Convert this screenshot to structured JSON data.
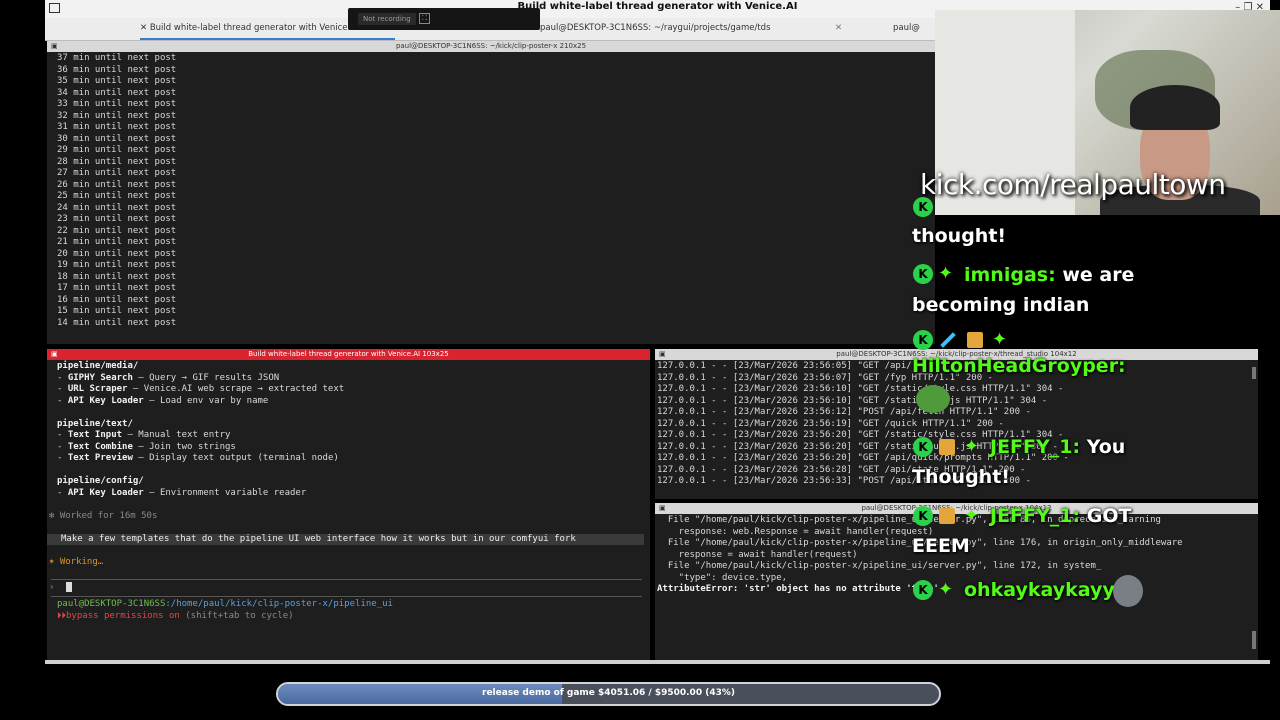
{
  "window": {
    "title": "Build white-label thread generator with Venice.AI",
    "controls": "–  ❐  ✕"
  },
  "recorder": {
    "status": "Not recording"
  },
  "tabs": [
    {
      "label": "Build white-label thread generator with Venice.AI"
    },
    {
      "label": "paul@DESKTOP-3C1N6SS: ~/raygui/projects/game/tds"
    },
    {
      "label": "paul@"
    }
  ],
  "pane_top": {
    "header": "paul@DESKTOP-3C1N6SS: ~/kick/clip-poster-x 210x25",
    "lines": [
      "37 min until next post",
      "36 min until next post",
      "35 min until next post",
      "34 min until next post",
      "33 min until next post",
      "32 min until next post",
      "31 min until next post",
      "30 min until next post",
      "29 min until next post",
      "28 min until next post",
      "27 min until next post",
      "26 min until next post",
      "25 min until next post",
      "24 min until next post",
      "23 min until next post",
      "22 min until next post",
      "21 min until next post",
      "20 min until next post",
      "19 min until next post",
      "18 min until next post",
      "17 min until next post",
      "16 min until next post",
      "15 min until next post",
      "14 min until next post"
    ]
  },
  "pane_claude": {
    "header": "Build white-label thread generator with Venice.AI 103x25",
    "media_heading": "pipeline/media/",
    "media_items": [
      {
        "name": "GIPHY Search",
        "desc": " — Query → GIF results JSON"
      },
      {
        "name": "URL Scraper",
        "desc": " — Venice.AI web scrape → extracted text"
      },
      {
        "name": "API Key Loader",
        "desc": " — Load env var by name"
      }
    ],
    "text_heading": "pipeline/text/",
    "text_items": [
      {
        "name": "Text Input",
        "desc": " — Manual text entry"
      },
      {
        "name": "Text Combine",
        "desc": " — Join two strings"
      },
      {
        "name": "Text Preview",
        "desc": " — Display text output (terminal node)"
      }
    ],
    "config_heading": "pipeline/config/",
    "config_items": [
      {
        "name": "API Key Loader",
        "desc": " — Environment variable reader"
      }
    ],
    "worked": "✻ Worked for 16m 50s",
    "prompt": "Make a few templates that do the pipeline UI web interface how it works but in our comfyui fork",
    "working": "✶ Working…",
    "input_prompt": "›",
    "cwd_user": "paul@DESKTOP-3C1N6SS",
    "cwd_path": ":/home/paul/kick/clip-poster-x/pipeline_ui",
    "bypass": "bypass permissions on",
    "bypass_hint": " (shift+tab to cycle)"
  },
  "pane_server": {
    "header": "paul@DESKTOP-3C1N6SS: ~/kick/clip-poster-x/thread_studio 104x12",
    "lines": [
      "127.0.0.1 - - [23/Mar/2026 23:56:05] \"GET /api/",
      "127.0.0.1 - - [23/Mar/2026 23:56:07] \"GET /fyp HTTP/1.1\" 200 -",
      "127.0.0.1 - - [23/Mar/2026 23:56:10] \"GET /static/style.css HTTP/1.1\" 304 -",
      "127.0.0.1 - - [23/Mar/2026 23:56:10] \"GET /static/app.js HTTP/1.1\" 304 -",
      "127.0.0.1 - - [23/Mar/2026 23:56:12] \"POST /api/fetch HTTP/1.1\" 200 -",
      "127.0.0.1 - - [23/Mar/2026 23:56:19] \"GET /quick HTTP/1.1\" 200 -",
      "127.0.0.1 - - [23/Mar/2026 23:56:20] \"GET /static/style.css HTTP/1.1\" 304 -",
      "127.0.0.1 - - [23/Mar/2026 23:56:20] \"GET /static/quick.js HTTP/1.1\" 304 -",
      "127.0.0.1 - - [23/Mar/2026 23:56:20] \"GET /api/quick/prompts HTTP/1.1\" 200 -",
      "127.0.0.1 - - [23/Mar/2026 23:56:28] \"GET /api/state HTTP/1.1\" 200 -",
      "127.0.0.1 - - [23/Mar/2026 23:56:33] \"POST /api/state HTTP/1.1\" 200 -"
    ]
  },
  "pane_error": {
    "header": "paul@DESKTOP-3C1N6SS: ~/kick/clip-poster-x 104x12",
    "lines": [
      "  File \"/home/paul/kick/clip-poster-x/pipeline_ui/server.py\", line 86, in deprecation_warning",
      "    response: web.Response = await handler(request)",
      "",
      "  File \"/home/paul/kick/clip-poster-x/pipeline_ui/server.py\", line 176, in origin_only_middleware",
      "    response = await handler(request)",
      "",
      "  File \"/home/paul/kick/clip-poster-x/pipeline_ui/server.py\", line 172, in system_",
      "    \"type\": device.type,",
      "",
      "AttributeError: 'str' object has no attribute 'type'"
    ]
  },
  "stream": {
    "url": "kick.com/realpaultown"
  },
  "chat": [
    {
      "user": "",
      "text": "thought!"
    },
    {
      "user": "imnigas:",
      "text": "we are",
      "text2": "becoming indian"
    },
    {
      "user": "HiltonHeadGroyper:",
      "text": ""
    },
    {
      "user": "JEFFY_1:",
      "text": "You",
      "text2": "Thought!"
    },
    {
      "user": "JEFFY_1:",
      "text": "GOT",
      "text2": "EEEM"
    },
    {
      "user": "ohkaykaykayy:",
      "text": ""
    }
  ],
  "goal": {
    "label": "release demo of game $4051.06 / $9500.00 (43%)",
    "progress": 0.43
  }
}
